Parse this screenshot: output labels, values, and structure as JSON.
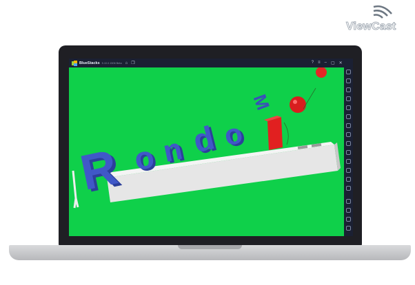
{
  "watermark": {
    "text": "ViewCast",
    "icon": "wifi-signal-icon"
  },
  "emulator": {
    "app_name": "BlueStacks",
    "version": "5.10.0.1506 Beta",
    "title_icons": [
      "home-icon",
      "multi-instance-icon"
    ],
    "window_controls": [
      "help-icon",
      "menu-icon",
      "minimize-icon",
      "maximize-icon",
      "close-icon",
      "sidebar-toggle-icon"
    ],
    "sidebar_icons": [
      "expand-icon",
      "volume-up-icon",
      "volume-down-icon",
      "screen-icon",
      "record-icon",
      "keyboard-icon",
      "rotate-icon",
      "shake-icon",
      "screenshot-icon",
      "location-icon",
      "folder-icon",
      "copy-icon",
      "eco-mode-icon",
      "sync-icon",
      "settings-icon",
      "back-icon",
      "home-icon",
      "recent-apps-icon"
    ],
    "background_color": "#0fd04a"
  },
  "game": {
    "logo_text": "Rondo",
    "logo_superscript": "M",
    "logo_color": "#3f56c8",
    "bar_color": "#dcdcdc"
  }
}
